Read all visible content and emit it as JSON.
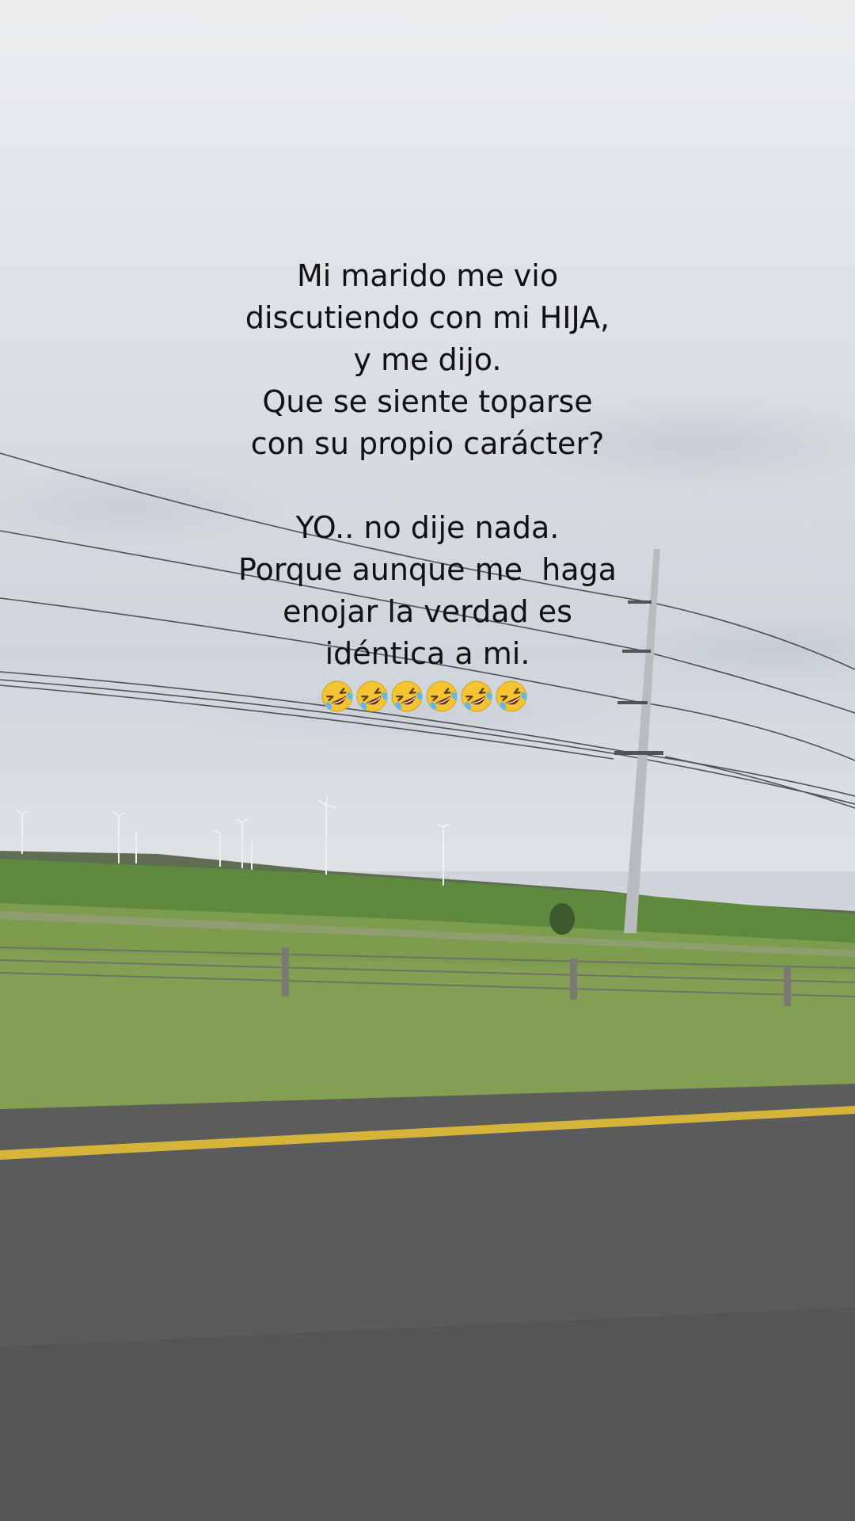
{
  "caption": {
    "lines": [
      "Mi marido me vio",
      "discutiendo con mi HIJA,",
      "y me dijo.",
      "Que se siente toparse",
      "con su propio carácter?",
      "",
      "YO.. no dije nada.",
      "Porque aunque me  haga",
      "enojar la verdad es",
      "idéntica a mi."
    ],
    "emoji_name": "rolling-on-the-floor-laughing-icon",
    "emoji_count": 6
  },
  "colors": {
    "text": "#111111",
    "road_line": "#d6b43a",
    "grass": "#7d9c4e"
  }
}
